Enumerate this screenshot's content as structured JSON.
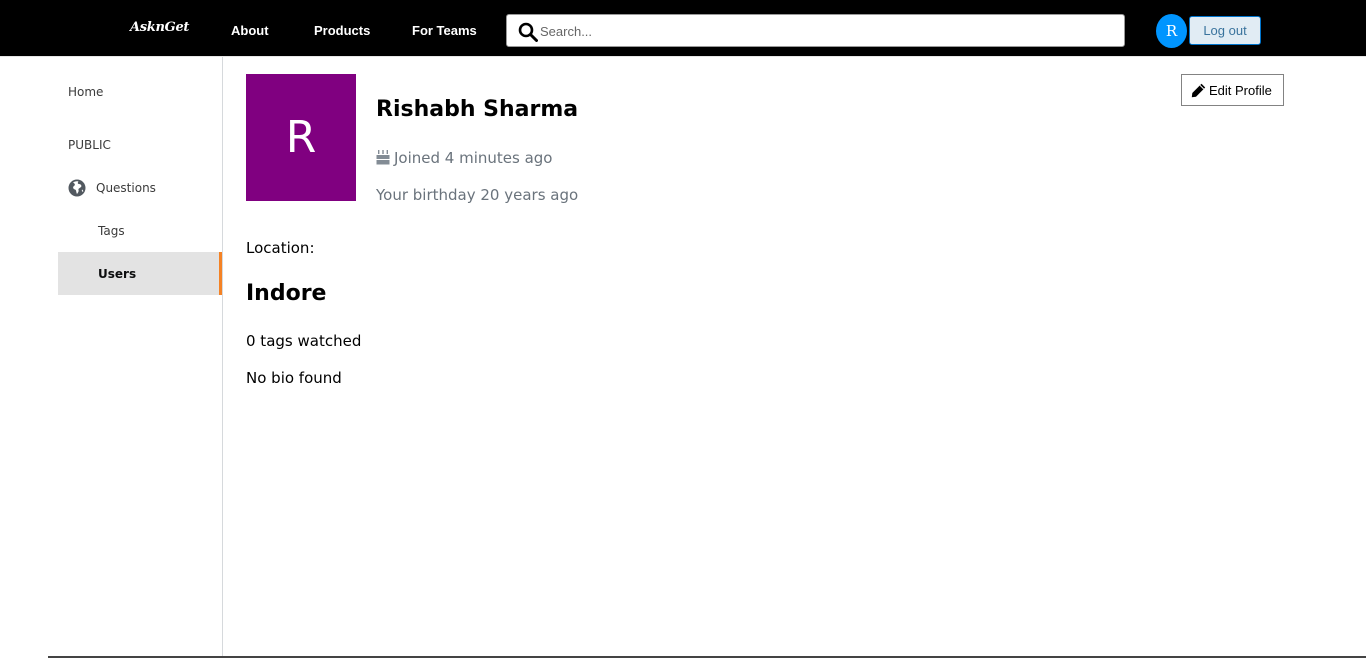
{
  "navbar": {
    "logo": "AsknGet",
    "links": [
      "About",
      "Products",
      "For Teams"
    ],
    "search_placeholder": "Search...",
    "avatar_initial": "R",
    "logout_label": "Log out",
    "logout_bg": "#e1ecf4",
    "avatar_color": "#0095ff"
  },
  "sidebar": {
    "home": "Home",
    "section": "PUBLIC",
    "questions": "Questions",
    "tags": "Tags",
    "users": "Users",
    "active_item": "Users",
    "active_accent": "#f48225"
  },
  "profile": {
    "avatar_initial": "R",
    "avatar_color": "#800080",
    "name": "Rishabh Sharma",
    "joined": "Joined 4 minutes ago",
    "birthday": "Your birthday 20 years ago",
    "edit_label": "Edit Profile",
    "location_label": "Location:",
    "location_value": "Indore",
    "tags_watched": "0 tags watched",
    "bio": "No bio found"
  }
}
